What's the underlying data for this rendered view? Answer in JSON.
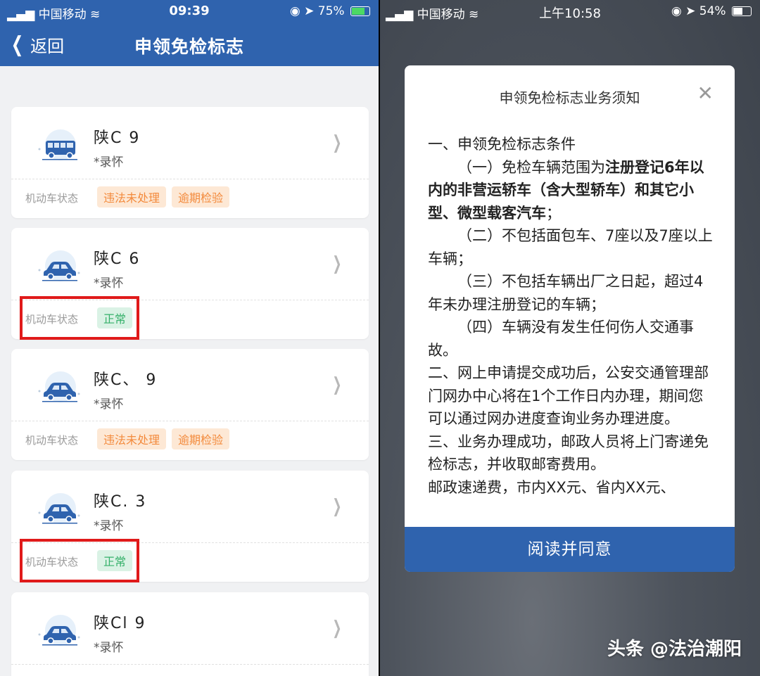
{
  "left": {
    "status": {
      "carrier": "中国移动",
      "time": "09:39",
      "battery": "75%"
    },
    "nav": {
      "back_label": "返回",
      "title": "申领免检标志"
    },
    "state_label": "机动车状态",
    "vehicles": [
      {
        "plate": "陕C      9",
        "owner": "*录怀",
        "tags": [
          "违法未处理",
          "逾期检验"
        ],
        "type": "bus"
      },
      {
        "plate": "陕C      6",
        "owner": "*录怀",
        "tags": [
          "正常"
        ],
        "type": "car"
      },
      {
        "plate": "陕C、     9",
        "owner": "*录怀",
        "tags": [
          "违法未处理",
          "逾期检验"
        ],
        "type": "car"
      },
      {
        "plate": "陕C.     3",
        "owner": "*录怀",
        "tags": [
          "正常"
        ],
        "type": "car"
      },
      {
        "plate": "陕Cl      9",
        "owner": "*录怀",
        "tags": [],
        "type": "car"
      }
    ]
  },
  "right": {
    "status": {
      "carrier": "中国移动",
      "time": "上午10:58",
      "battery": "54%"
    },
    "modal": {
      "title": "申领免检标志业务须知",
      "agree_label": "阅读并同意",
      "body": {
        "s1": "一、申领免检标志条件",
        "c1_pre": "（一）免检车辆范围为",
        "c1_bold": "注册登记6年以内的非营运轿车（含大型轿车）和其它小型、微型载客汽车",
        "c1_post": "；",
        "c2": "（二）不包括面包车、7座以及7座以上车辆；",
        "c3": "（三）不包括车辆出厂之日起，超过4年未办理注册登记的车辆；",
        "c4": "（四）车辆没有发生任何伤人交通事故。",
        "s2": "二、网上申请提交成功后，公安交通管理部门网办中心将在1个工作日内办理，期间您可以通过网办进度查询业务办理进度。",
        "s3": "三、业务办理成功，邮政人员将上门寄递免检标志，并收取邮寄费用。",
        "s4": "邮政速递费，市内XX元、省内XX元、"
      }
    }
  },
  "watermark": "头条 @法治潮阳",
  "colors": {
    "brand_blue": "#2f63ae",
    "tag_orange": "#f38a3c",
    "tag_green": "#35b06a",
    "highlight_red": "#e01a1a"
  }
}
